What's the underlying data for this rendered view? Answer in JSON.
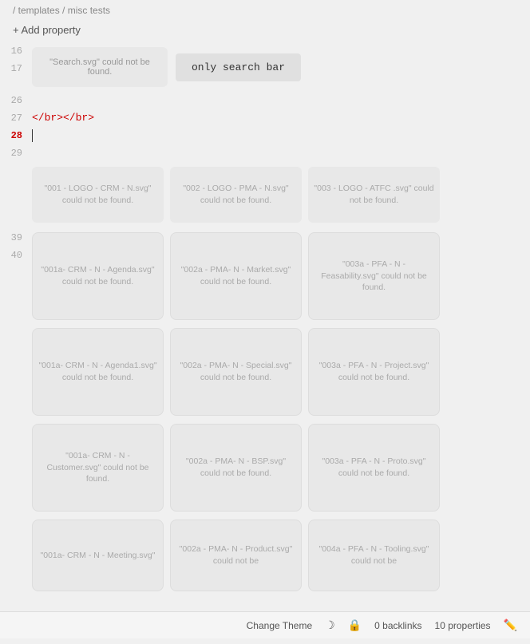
{
  "breadcrumb": {
    "text": "/ templates / misc tests"
  },
  "add_property": {
    "label": "+ Add property"
  },
  "lines": {
    "16": "16",
    "17": "17",
    "26": "26",
    "27": "27",
    "28": "28",
    "29": "29",
    "39": "39",
    "40": "40"
  },
  "image_cards": {
    "search_svg": "\"Search.svg\" could not be found.",
    "search_bar_label": "only search bar",
    "code_tag": "</br></br>",
    "logo001": "\"001 - LOGO - CRM - N.svg\" could not be found.",
    "logo002": "\"002 - LOGO - PMA - N.svg\" could not be found.",
    "logo003": "\"003 - LOGO - ATFC .svg\" could not be found.",
    "card_001a_agenda": "\"001a- CRM - N - Agenda.svg\" could not be found.",
    "card_002a_market": "\"002a - PMA- N - Market.svg\" could not be found.",
    "card_003a_feasibility": "\"003a - PFA - N - Feasability.svg\" could not be found.",
    "card_001a_agenda1": "\"001a- CRM - N - Agenda1.svg\" could not be found.",
    "card_002a_special": "\"002a - PMA- N - Special.svg\" could not be found.",
    "card_003a_project": "\"003a - PFA - N - Project.svg\" could not be found.",
    "card_001a_customer": "\"001a- CRM - N - Customer.svg\" could not be found.",
    "card_002a_bsp": "\"002a - PMA- N - BSP.svg\" could not be found.",
    "card_003a_proto": "\"003a - PFA - N - Proto.svg\" could not be found.",
    "card_001a_meeting": "\"001a- CRM - N - Meeting.svg\"",
    "card_002a_product": "\"002a - PMA- N - Product.svg\" could not be",
    "card_004a_tooling": "\"004a - PFA - N - Tooling.svg\" could not be"
  },
  "bottom_bar": {
    "change_theme": "Change Theme",
    "backlinks": "0 backlinks",
    "properties": "10 properties"
  }
}
